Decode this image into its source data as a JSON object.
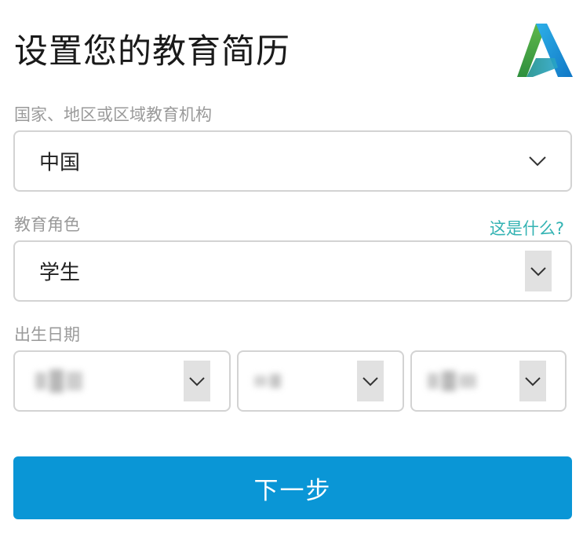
{
  "page": {
    "title": "设置您的教育简历",
    "logo": "autodesk-logo"
  },
  "institution": {
    "label": "国家、地区或区域教育机构",
    "value": "中国",
    "icon": "chevron-down-icon"
  },
  "role": {
    "label": "教育角色",
    "help_link": "这是什么?",
    "value": "学生",
    "icon": "chevron-down-icon"
  },
  "birthdate": {
    "label": "出生日期",
    "year_value": "",
    "month_value": "",
    "day_value": "",
    "icon": "chevron-down-icon"
  },
  "actions": {
    "next_label": "下一步",
    "next_color": "#0a96d6"
  },
  "colors": {
    "label_text": "#9a9a9a",
    "link": "#33b3b3",
    "border": "#d3d3d3",
    "chevron_bg": "#e1e1e1"
  }
}
